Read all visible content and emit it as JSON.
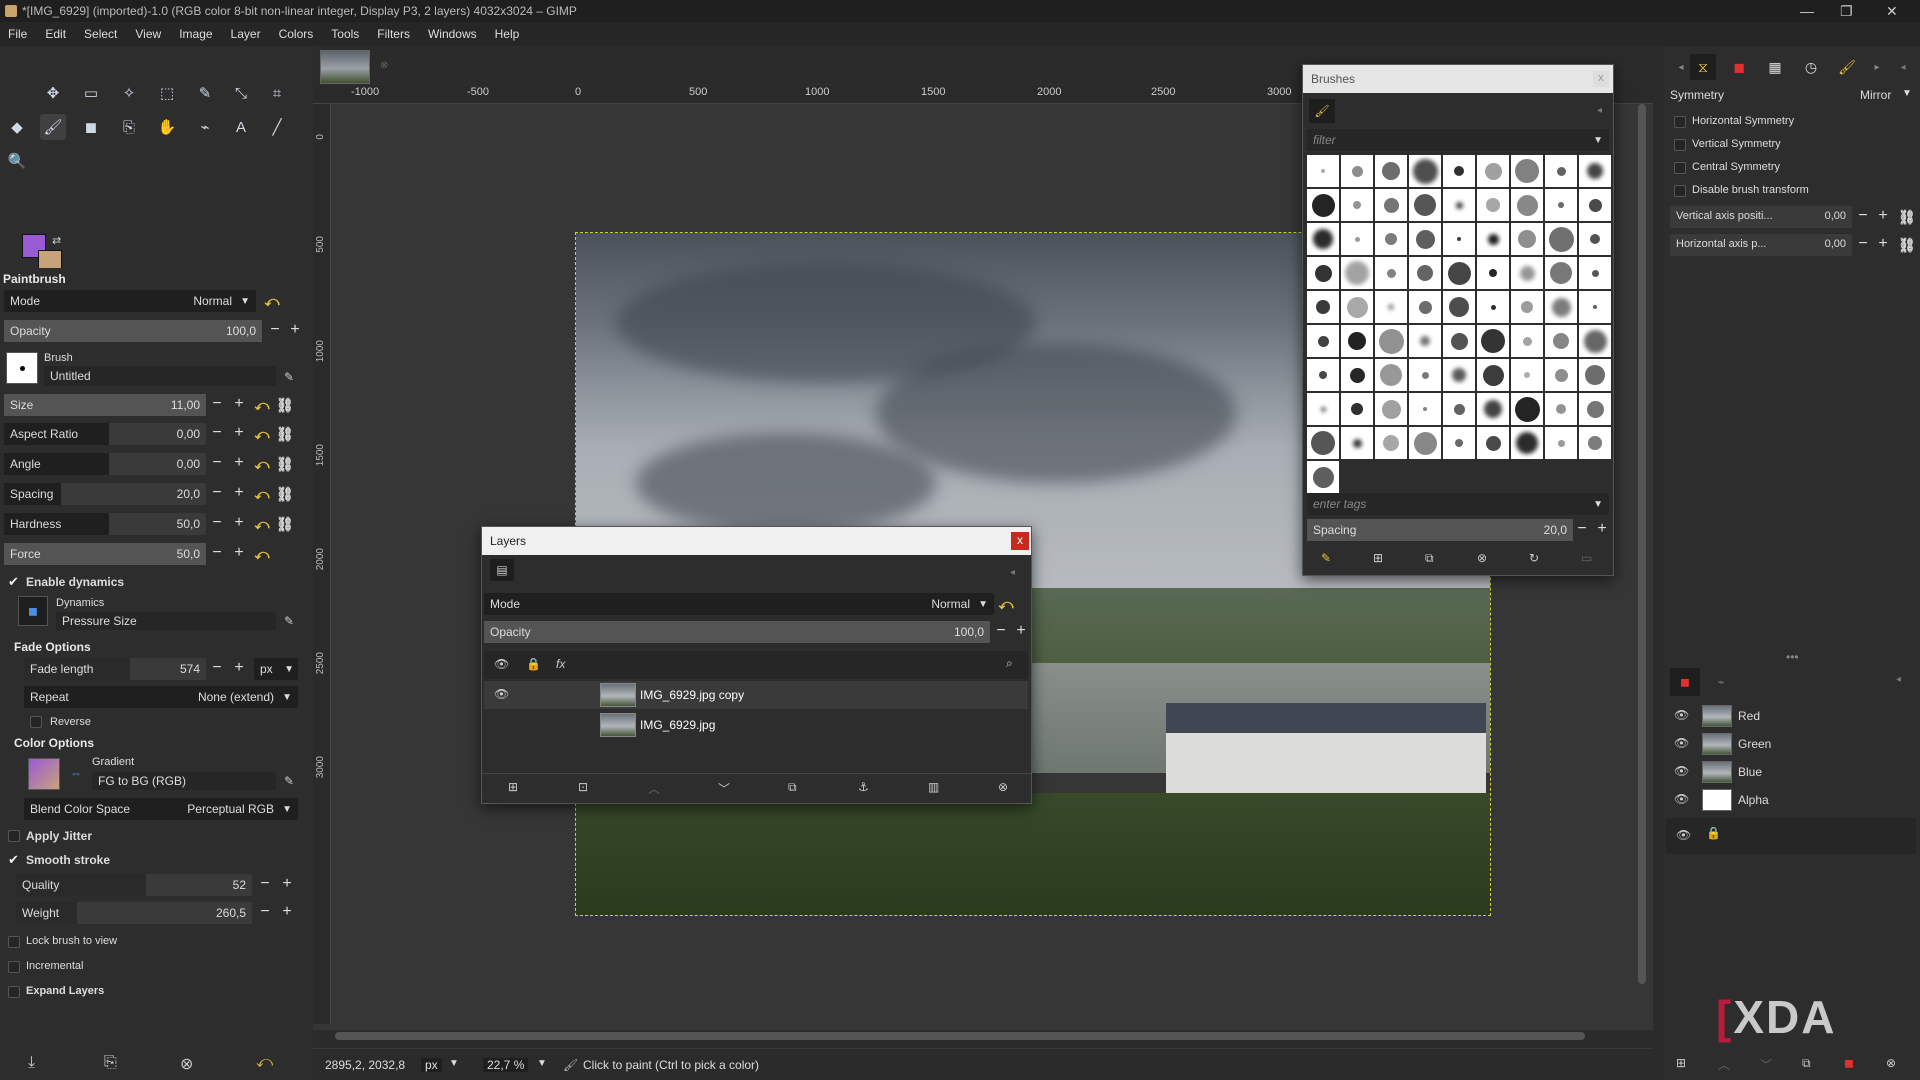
{
  "window_title": "*[IMG_6929] (imported)-1.0 (RGB color 8-bit non-linear integer, Display P3, 2 layers) 4032x3024 – GIMP",
  "window_controls": [
    "—",
    "❐",
    "✕"
  ],
  "menu": [
    "File",
    "Edit",
    "Select",
    "View",
    "Image",
    "Layer",
    "Colors",
    "Tools",
    "Filters",
    "Windows",
    "Help"
  ],
  "colors": {
    "fg": "#9a5ad6",
    "bg": "#c8a27a",
    "accent": "#e8c23a",
    "close_red": "#c42b1c"
  },
  "tool_options": {
    "title": "Paintbrush",
    "mode_label": "Mode",
    "mode_value": "Normal",
    "opacity_label": "Opacity",
    "opacity_value": "100,0",
    "brush_label": "Brush",
    "brush_name": "Untitled",
    "size_label": "Size",
    "size_value": "11,00",
    "aspect_label": "Aspect Ratio",
    "aspect_value": "0,00",
    "angle_label": "Angle",
    "angle_value": "0,00",
    "spacing_label": "Spacing",
    "spacing_value": "20,0",
    "hardness_label": "Hardness",
    "hardness_value": "50,0",
    "force_label": "Force",
    "force_value": "50,0",
    "enable_dynamics": "Enable dynamics",
    "dynamics_label": "Dynamics",
    "dynamics_value": "Pressure Size",
    "fade_options": "Fade Options",
    "fade_length_label": "Fade length",
    "fade_length_value": "574",
    "fade_unit": "px",
    "repeat_label": "Repeat",
    "repeat_value": "None (extend)",
    "reverse": "Reverse",
    "color_options": "Color Options",
    "gradient_label": "Gradient",
    "gradient_value": "FG to BG (RGB)",
    "blend_space_label": "Blend Color Space",
    "blend_space_value": "Perceptual RGB",
    "apply_jitter": "Apply Jitter",
    "smooth_stroke": "Smooth stroke",
    "quality_label": "Quality",
    "quality_value": "52",
    "weight_label": "Weight",
    "weight_value": "260,5",
    "lock_brush": "Lock brush to view",
    "incremental": "Incremental",
    "expand_layers": "Expand Layers"
  },
  "ruler": [
    "-1000",
    "-500",
    "0",
    "500",
    "1000",
    "1500",
    "2000",
    "2500",
    "3000"
  ],
  "vruler": [
    "0",
    "500",
    "1000",
    "1500",
    "2000",
    "2500",
    "3000"
  ],
  "status": {
    "coords": "2895,2, 2032,8",
    "unit": "px",
    "zoom": "22,7 %",
    "hint": "Click to paint (Ctrl to pick a color)"
  },
  "layers_dialog": {
    "title": "Layers",
    "close": "x",
    "mode_label": "Mode",
    "mode_value": "Normal",
    "opacity_label": "Opacity",
    "opacity_value": "100,0",
    "fx": "fx",
    "layers": [
      {
        "name": "IMG_6929.jpg copy",
        "visible": true
      },
      {
        "name": "IMG_6929.jpg",
        "visible": false
      }
    ]
  },
  "brushes_dialog": {
    "title": "Brushes",
    "close": "x",
    "filter_placeholder": "filter",
    "tags_placeholder": "enter tags",
    "spacing_label": "Spacing",
    "spacing_value": "20,0"
  },
  "symmetry": {
    "title": "Symmetry",
    "mode": "Mirror",
    "horizontal": "Horizontal Symmetry",
    "vertical": "Vertical Symmetry",
    "central": "Central Symmetry",
    "disable_transform": "Disable brush transform",
    "vaxis_label": "Vertical axis positi...",
    "vaxis_value": "0,00",
    "haxis_label": "Horizontal axis p...",
    "haxis_value": "0,00"
  },
  "channels": [
    {
      "name": "Red"
    },
    {
      "name": "Green"
    },
    {
      "name": "Blue"
    },
    {
      "name": "Alpha"
    }
  ],
  "watermark": "XDA"
}
